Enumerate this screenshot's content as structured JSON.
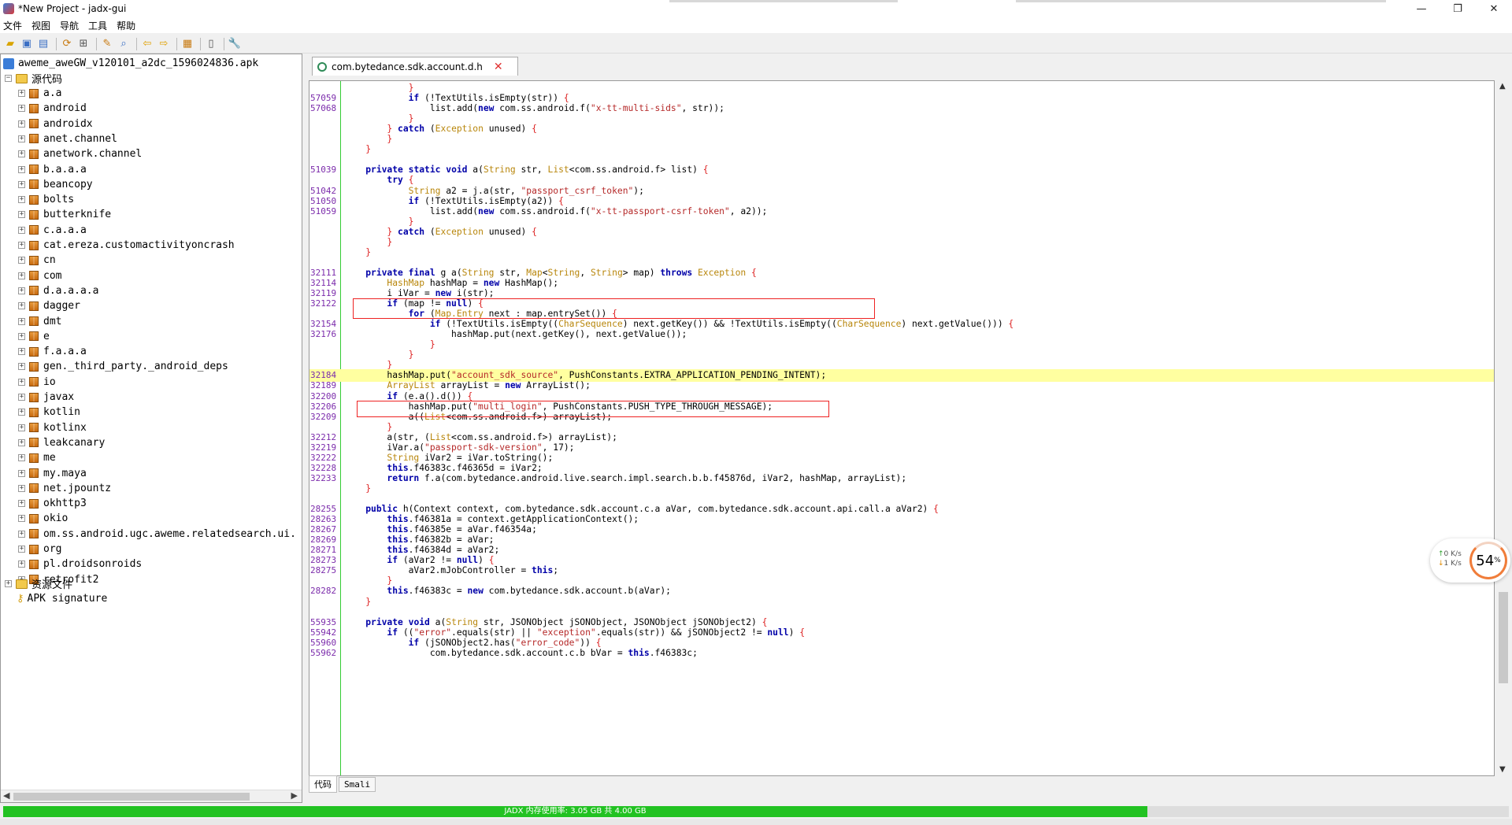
{
  "window": {
    "title": "*New Project - jadx-gui",
    "controls": [
      "—",
      "❐",
      "✕"
    ]
  },
  "menu": [
    "文件",
    "视图",
    "导航",
    "工具",
    "帮助"
  ],
  "toolbar_icons": [
    "open-file-icon",
    "save-all-icon",
    "export-icon",
    "sync-icon",
    "flatten-packages-icon",
    "text-search-icon",
    "class-search-icon",
    "back-icon",
    "forward-icon",
    "deobfuscation-icon",
    "log-viewer-icon",
    "preferences-icon"
  ],
  "tree": {
    "root": "aweme_aweGW_v120101_a2dc_1596024836.apk",
    "source_folder": "源代码",
    "packages": [
      "a.a",
      "android",
      "androidx",
      "anet.channel",
      "anetwork.channel",
      "b.a.a.a",
      "beancopy",
      "bolts",
      "butterknife",
      "c.a.a.a",
      "cat.ereza.customactivityoncrash",
      "cn",
      "com",
      "d.a.a.a.a",
      "dagger",
      "dmt",
      "e",
      "f.a.a.a",
      "gen._third_party._android_deps",
      "io",
      "javax",
      "kotlin",
      "kotlinx",
      "leakcanary",
      "me",
      "my.maya",
      "net.jpountz",
      "okhttp3",
      "okio",
      "om.ss.android.ugc.aweme.relatedsearch.ui.",
      "org",
      "pl.droidsonroids",
      "retrofit2"
    ],
    "resources_folder": "资源文件",
    "apk_signature": "APK signature"
  },
  "editor": {
    "tab_label": "com.bytedance.sdk.account.d.h",
    "bottom_tabs": [
      "代码",
      "Smali"
    ]
  },
  "code": [
    {
      "n": "",
      "t": "            }"
    },
    {
      "n": "57059",
      "t": "            if (!TextUtils.isEmpty(str)) {"
    },
    {
      "n": "57068",
      "t": "                list.add(new com.ss.android.f(\"x-tt-multi-sids\", str));"
    },
    {
      "n": "",
      "t": "            }"
    },
    {
      "n": "",
      "t": "        } catch (Exception unused) {"
    },
    {
      "n": "",
      "t": "        }"
    },
    {
      "n": "",
      "t": "    }"
    },
    {
      "n": "",
      "t": ""
    },
    {
      "n": "51039",
      "t": "    private static void a(String str, List<com.ss.android.f> list) {"
    },
    {
      "n": "",
      "t": "        try {"
    },
    {
      "n": "51042",
      "t": "            String a2 = j.a(str, \"passport_csrf_token\");"
    },
    {
      "n": "51050",
      "t": "            if (!TextUtils.isEmpty(a2)) {"
    },
    {
      "n": "51059",
      "t": "                list.add(new com.ss.android.f(\"x-tt-passport-csrf-token\", a2));"
    },
    {
      "n": "",
      "t": "            }"
    },
    {
      "n": "",
      "t": "        } catch (Exception unused) {"
    },
    {
      "n": "",
      "t": "        }"
    },
    {
      "n": "",
      "t": "    }"
    },
    {
      "n": "",
      "t": ""
    },
    {
      "n": "32111",
      "t": "    private final g a(String str, Map<String, String> map) throws Exception {"
    },
    {
      "n": "32114",
      "t": "        HashMap hashMap = new HashMap();"
    },
    {
      "n": "32119",
      "t": "        i iVar = new i(str);"
    },
    {
      "n": "32122",
      "t": "        if (map != null) {"
    },
    {
      "n": "",
      "t": "            for (Map.Entry next : map.entrySet()) {"
    },
    {
      "n": "32154",
      "t": "                if (!TextUtils.isEmpty((CharSequence) next.getKey()) && !TextUtils.isEmpty((CharSequence) next.getValue())) {"
    },
    {
      "n": "32176",
      "t": "                    hashMap.put(next.getKey(), next.getValue());"
    },
    {
      "n": "",
      "t": "                }"
    },
    {
      "n": "",
      "t": "            }"
    },
    {
      "n": "",
      "t": "        }"
    },
    {
      "n": "32184",
      "t": "        hashMap.put(\"account_sdk_source\", PushConstants.EXTRA_APPLICATION_PENDING_INTENT);",
      "hl": true
    },
    {
      "n": "32189",
      "t": "        ArrayList arrayList = new ArrayList();"
    },
    {
      "n": "32200",
      "t": "        if (e.a().d()) {"
    },
    {
      "n": "32206",
      "t": "            hashMap.put(\"multi_login\", PushConstants.PUSH_TYPE_THROUGH_MESSAGE);"
    },
    {
      "n": "32209",
      "t": "            a((List<com.ss.android.f>) arrayList);"
    },
    {
      "n": "",
      "t": "        }"
    },
    {
      "n": "32212",
      "t": "        a(str, (List<com.ss.android.f>) arrayList);"
    },
    {
      "n": "32219",
      "t": "        iVar.a(\"passport-sdk-version\", 17);"
    },
    {
      "n": "32222",
      "t": "        String iVar2 = iVar.toString();"
    },
    {
      "n": "32228",
      "t": "        this.f46383c.f46365d = iVar2;"
    },
    {
      "n": "32233",
      "t": "        return f.a(com.bytedance.android.live.search.impl.search.b.b.f45876d, iVar2, hashMap, arrayList);"
    },
    {
      "n": "",
      "t": "    }"
    },
    {
      "n": "",
      "t": ""
    },
    {
      "n": "28255",
      "t": "    public h(Context context, com.bytedance.sdk.account.c.a aVar, com.bytedance.sdk.account.api.call.a aVar2) {"
    },
    {
      "n": "28263",
      "t": "        this.f46381a = context.getApplicationContext();"
    },
    {
      "n": "28267",
      "t": "        this.f46385e = aVar.f46354a;"
    },
    {
      "n": "28269",
      "t": "        this.f46382b = aVar;"
    },
    {
      "n": "28271",
      "t": "        this.f46384d = aVar2;"
    },
    {
      "n": "28273",
      "t": "        if (aVar2 != null) {"
    },
    {
      "n": "28275",
      "t": "            aVar2.mJobController = this;"
    },
    {
      "n": "",
      "t": "        }"
    },
    {
      "n": "28282",
      "t": "        this.f46383c = new com.bytedance.sdk.account.b(aVar);"
    },
    {
      "n": "",
      "t": "    }"
    },
    {
      "n": "",
      "t": ""
    },
    {
      "n": "55935",
      "t": "    private void a(String str, JSONObject jSONObject, JSONObject jSONObject2) {"
    },
    {
      "n": "55942",
      "t": "        if ((\"error\".equals(str) || \"exception\".equals(str)) && jSONObject2 != null) {"
    },
    {
      "n": "55960",
      "t": "            if (jSONObject2.has(\"error_code\")) {"
    },
    {
      "n": "55962",
      "t": "                com.bytedance.sdk.account.c.b bVar = this.f46383c;"
    }
  ],
  "net_widget": {
    "up": "0  K/s",
    "down": "1  K/s",
    "percent": "54",
    "percent_sign": "%"
  },
  "status": {
    "memory": "JADX 内存使用率: 3.05 GB 共 4.00 GB",
    "memory_fraction": 0.76,
    "colors": {
      "memory_bar": "#22c222"
    }
  }
}
